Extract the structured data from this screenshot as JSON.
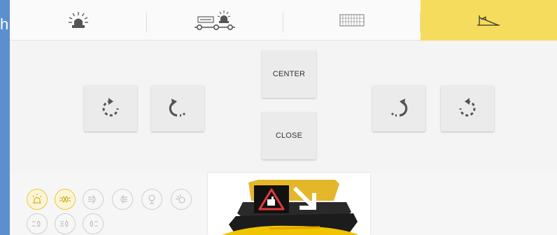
{
  "window": {
    "edge_text": "h"
  },
  "tabs": [
    {
      "icon": "beacon-light-icon",
      "active": false
    },
    {
      "icon": "trailer-beacon-icon",
      "active": false
    },
    {
      "icon": "keyboard-icon",
      "active": false
    },
    {
      "icon": "ramp-slope-icon",
      "active": true
    }
  ],
  "controls": {
    "center_label": "CENTER",
    "close_label": "CLOSE",
    "rotate_left_1_icon": "rotate-dotted-clockwise-icon",
    "rotate_left_2_icon": "rotate-clockwise-icon",
    "rotate_right_1_icon": "rotate-counterclockwise-icon",
    "rotate_right_2_icon": "rotate-dotted-counterclockwise-icon"
  },
  "indicators": [
    {
      "icon": "beacon-indicator-icon",
      "active": true
    },
    {
      "icon": "headlight-indicator-icon",
      "active": true
    },
    {
      "icon": "fog-light-indicator-icon",
      "active": false
    },
    {
      "icon": "high-beam-indicator-icon",
      "active": false
    },
    {
      "icon": "work-light-indicator-icon",
      "active": false
    },
    {
      "icon": "side-light-indicator-icon",
      "active": false
    },
    {
      "icon": "rear-light-indicator-icon",
      "active": false
    },
    {
      "icon": "rear-fog-indicator-icon",
      "active": false
    },
    {
      "icon": "reverse-light-indicator-icon",
      "active": false
    }
  ],
  "colors": {
    "accent": "#f6dc5c",
    "indicator_on": "#e8c93a",
    "side_strip": "#5b8fd0"
  }
}
